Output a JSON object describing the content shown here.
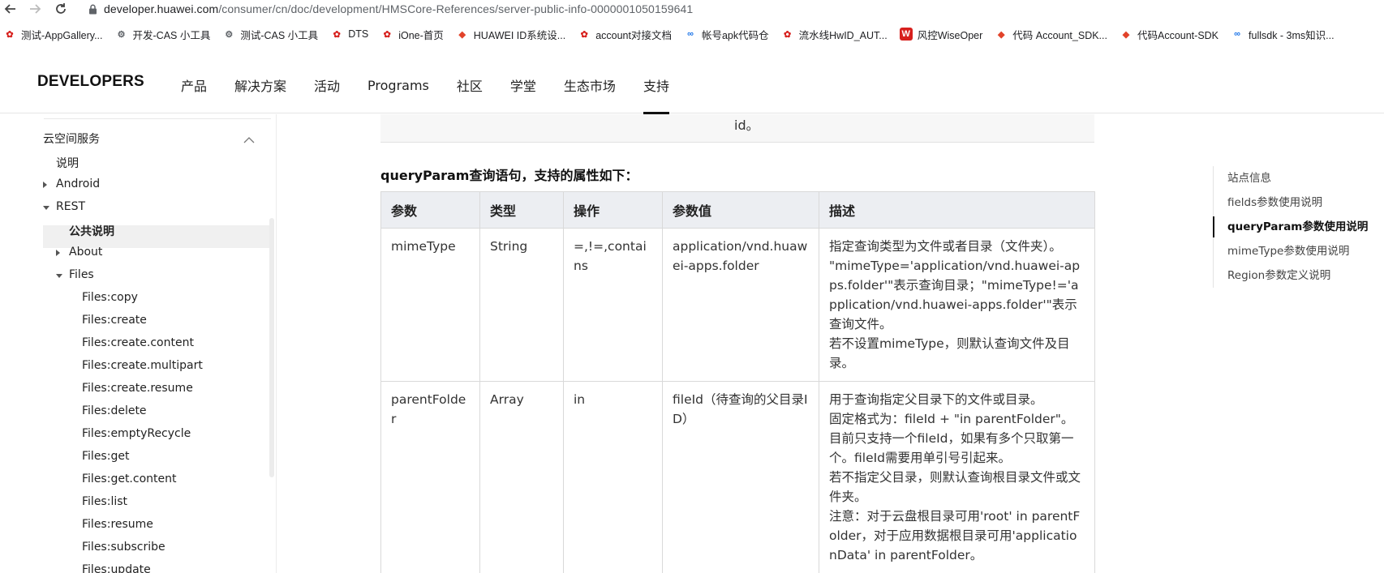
{
  "browser": {
    "url_host": "developer.huawei.com",
    "url_path": "/consumer/cn/doc/development/HMSCore-References/server-public-info-0000001050159641"
  },
  "bookmarks": [
    {
      "label": "测试-AppGallery...",
      "icon": "huawei-icon"
    },
    {
      "label": "开发-CAS 小工具",
      "icon": "gear-icon"
    },
    {
      "label": "测试-CAS 小工具",
      "icon": "gear-icon"
    },
    {
      "label": "DTS",
      "icon": "huawei-icon"
    },
    {
      "label": "iOne-首页",
      "icon": "huawei-icon"
    },
    {
      "label": "HUAWEI ID系统设...",
      "icon": "gitlab-icon"
    },
    {
      "label": "account对接文档",
      "icon": "huawei-icon"
    },
    {
      "label": "帐号apk代码仓",
      "icon": "blue-link-icon"
    },
    {
      "label": "流水线HwID_AUT...",
      "icon": "huawei-icon"
    },
    {
      "label": "风控WiseOper",
      "icon": "wiseoper-icon"
    },
    {
      "label": "代码 Account_SDK...",
      "icon": "gitlab-icon"
    },
    {
      "label": "代码Account-SDK",
      "icon": "gitlab-icon"
    },
    {
      "label": "fullsdk - 3ms知识...",
      "icon": "blue-link-icon"
    }
  ],
  "header": {
    "logo": "DEVELOPERS",
    "nav": [
      "产品",
      "解决方案",
      "活动",
      "Programs",
      "社区",
      "学堂",
      "生态市场",
      "支持"
    ],
    "active_nav": "支持"
  },
  "sidebar": {
    "section": "云空间服务",
    "items": [
      {
        "label": "说明",
        "level": 1
      },
      {
        "label": "Android",
        "level": 1,
        "caret": "right"
      },
      {
        "label": "REST",
        "level": 1,
        "caret": "down"
      },
      {
        "label": "公共说明",
        "level": 2,
        "selected": true
      },
      {
        "label": "About",
        "level": 2,
        "caret": "right"
      },
      {
        "label": "Files",
        "level": 2,
        "caret": "down"
      },
      {
        "label": "Files:copy",
        "level": 3
      },
      {
        "label": "Files:create",
        "level": 3
      },
      {
        "label": "Files:create.content",
        "level": 3
      },
      {
        "label": "Files:create.multipart",
        "level": 3
      },
      {
        "label": "Files:create.resume",
        "level": 3
      },
      {
        "label": "Files:delete",
        "level": 3
      },
      {
        "label": "Files:emptyRecycle",
        "level": 3
      },
      {
        "label": "Files:get",
        "level": 3
      },
      {
        "label": "Files:get.content",
        "level": 3
      },
      {
        "label": "Files:list",
        "level": 3
      },
      {
        "label": "Files:resume",
        "level": 3
      },
      {
        "label": "Files:subscribe",
        "level": 3
      },
      {
        "label": "Files:update",
        "level": 3
      }
    ]
  },
  "main": {
    "prev_row_tail": "id。",
    "section_title": "queryParam查询语句，支持的属性如下：",
    "table": {
      "headers": [
        "参数",
        "类型",
        "操作",
        "参数值",
        "描述"
      ],
      "rows": [
        {
          "param": "mimeType",
          "type": "String",
          "op": "=,!=,contains",
          "value": "application/vnd.huawei-apps.folder",
          "desc": [
            "指定查询类型为文件或者目录（文件夹）。",
            "\"mimeType='application/vnd.huawei-apps.folder'\"表示查询目录；\"mimeType!='application/vnd.huawei-apps.folder'\"表示查询文件。",
            "若不设置mimeType，则默认查询文件及目录。"
          ]
        },
        {
          "param": "parentFolder",
          "type": "Array",
          "op": "in",
          "value": "fileId（待查询的父目录ID）",
          "desc": [
            "用于查询指定父目录下的文件或目录。",
            "固定格式为：fileId + \"in parentFolder\"。",
            "目前只支持一个fileId，如果有多个只取第一个。fileId需要用单引号引起来。",
            "若不指定父目录，则默认查询根目录文件或文件夹。",
            "注意：对于云盘根目录可用'root' in parentFolder，对于应用数据根目录可用'applicationData' in parentFolder。"
          ]
        }
      ]
    }
  },
  "anchor_nav": {
    "items": [
      "站点信息",
      "fields参数使用说明",
      "queryParam参数使用说明",
      "mimeType参数使用说明",
      "Region参数定义说明"
    ],
    "active": "queryParam参数使用说明"
  }
}
